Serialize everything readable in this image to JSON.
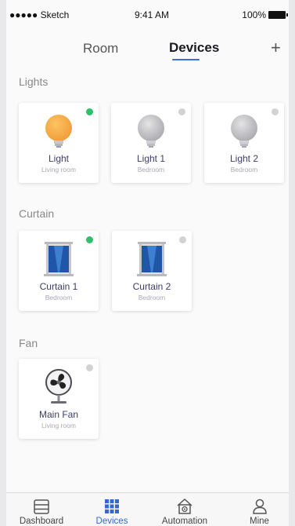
{
  "status_bar": {
    "carrier": "●●●●● Sketch",
    "time": "9:41 AM",
    "battery": "100%"
  },
  "header": {
    "tab_room": "Room",
    "tab_devices": "Devices",
    "add_label": "+"
  },
  "sections": [
    {
      "title": "Lights",
      "devices": [
        {
          "name": "Light",
          "room": "Living room",
          "on": true,
          "icon": "bulb-on-icon"
        },
        {
          "name": "Light 1",
          "room": "Bedroom",
          "on": false,
          "icon": "bulb-off-icon"
        },
        {
          "name": "Light 2",
          "room": "Bedroom",
          "on": false,
          "icon": "bulb-off-icon"
        }
      ]
    },
    {
      "title": "Curtain",
      "devices": [
        {
          "name": "Curtain 1",
          "room": "Bedroom",
          "on": true,
          "icon": "curtain-icon"
        },
        {
          "name": "Curtain 2",
          "room": "Bedroom",
          "on": false,
          "icon": "curtain-icon"
        }
      ]
    },
    {
      "title": "Fan",
      "devices": [
        {
          "name": "Main Fan",
          "room": "Living room",
          "on": false,
          "icon": "fan-icon"
        }
      ]
    }
  ],
  "bottom_nav": [
    {
      "label": "Dashboard",
      "icon": "dashboard-icon",
      "active": false
    },
    {
      "label": "Devices",
      "icon": "devices-grid-icon",
      "active": true
    },
    {
      "label": "Automation",
      "icon": "automation-home-icon",
      "active": false
    },
    {
      "label": "Mine",
      "icon": "user-icon",
      "active": false
    }
  ],
  "colors": {
    "accent": "#2d6ad8",
    "status_on": "#2dbf6a",
    "status_off": "#d2d2d2",
    "bulb_on": "#f5a640"
  }
}
